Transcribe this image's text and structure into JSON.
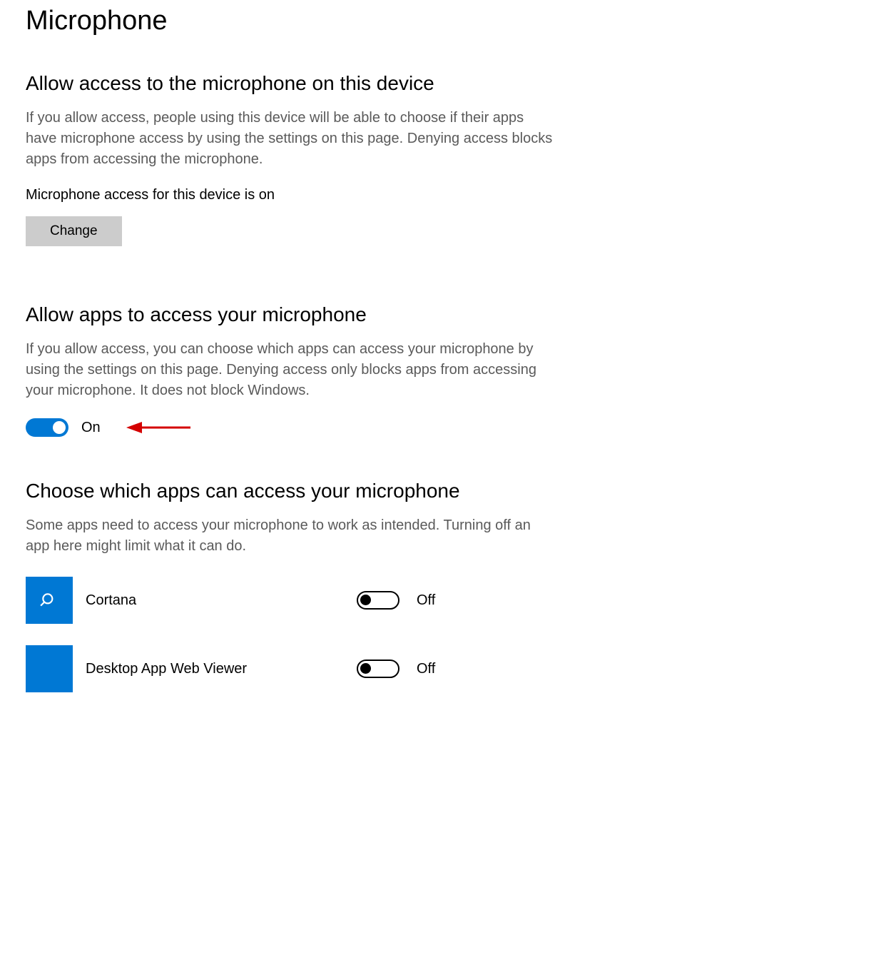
{
  "page": {
    "title": "Microphone"
  },
  "section1": {
    "heading": "Allow access to the microphone on this device",
    "body": "If you allow access, people using this device will be able to choose if their apps have microphone access by using the settings on this page. Denying access blocks apps from accessing the microphone.",
    "status": "Microphone access for this device is on",
    "change_label": "Change"
  },
  "section2": {
    "heading": "Allow apps to access your microphone",
    "body": "If you allow access, you can choose which apps can access your microphone by using the settings on this page. Denying access only blocks apps from accessing your microphone. It does not block Windows.",
    "toggle_state": "On"
  },
  "section3": {
    "heading": "Choose which apps can access your microphone",
    "body": "Some apps need to access your microphone to work as intended. Turning off an app here might limit what it can do.",
    "apps": [
      {
        "name": "Cortana",
        "state": "Off",
        "icon": "search"
      },
      {
        "name": "Desktop App Web Viewer",
        "state": "Off",
        "icon": "blank"
      }
    ]
  },
  "colors": {
    "accent": "#0078d4",
    "annotation_red": "#d40000"
  }
}
